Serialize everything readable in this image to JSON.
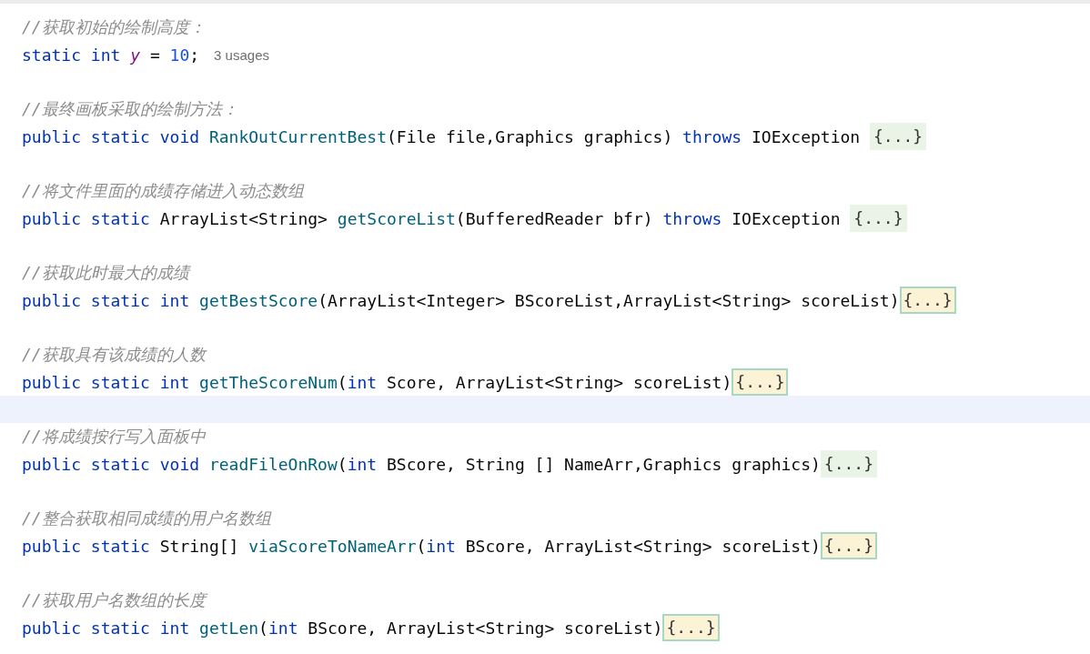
{
  "editor": {
    "lines": [
      {
        "kind": "comment",
        "text": "//获取初始的绘制高度："
      },
      {
        "kind": "code",
        "tokens": [
          {
            "kind": "keyword",
            "text": "static int "
          },
          {
            "kind": "field",
            "text": "y"
          },
          {
            "kind": "plain",
            "text": " = "
          },
          {
            "kind": "number",
            "text": "10"
          },
          {
            "kind": "plain",
            "text": ";"
          }
        ],
        "hint": "3 usages"
      },
      {
        "kind": "blank"
      },
      {
        "kind": "comment",
        "text": "//最终画板采取的绘制方法："
      },
      {
        "kind": "code",
        "tokens": [
          {
            "kind": "keyword",
            "text": "public static void "
          },
          {
            "kind": "function",
            "text": "RankOutCurrentBest"
          },
          {
            "kind": "plain",
            "text": "(File file,Graphics graphics) "
          },
          {
            "kind": "keyword",
            "text": "throws "
          },
          {
            "kind": "plain",
            "text": "IOException "
          }
        ],
        "fold": {
          "text": "{...}",
          "selected": false
        }
      },
      {
        "kind": "blank"
      },
      {
        "kind": "comment",
        "text": "//将文件里面的成绩存储进入动态数组"
      },
      {
        "kind": "code",
        "tokens": [
          {
            "kind": "keyword",
            "text": "public static "
          },
          {
            "kind": "plain",
            "text": "ArrayList<String> "
          },
          {
            "kind": "function",
            "text": "getScoreList"
          },
          {
            "kind": "plain",
            "text": "(BufferedReader bfr) "
          },
          {
            "kind": "keyword",
            "text": "throws "
          },
          {
            "kind": "plain",
            "text": "IOException "
          }
        ],
        "fold": {
          "text": "{...}",
          "selected": false
        }
      },
      {
        "kind": "blank"
      },
      {
        "kind": "comment",
        "text": "//获取此时最大的成绩"
      },
      {
        "kind": "code",
        "tokens": [
          {
            "kind": "keyword",
            "text": "public static int "
          },
          {
            "kind": "function",
            "text": "getBestScore"
          },
          {
            "kind": "plain",
            "text": "(ArrayList<Integer> BScoreList,ArrayList<String> scoreList)"
          }
        ],
        "fold": {
          "text": "{...}",
          "selected": true
        }
      },
      {
        "kind": "blank"
      },
      {
        "kind": "comment",
        "text": "//获取具有该成绩的人数"
      },
      {
        "kind": "code",
        "tokens": [
          {
            "kind": "keyword",
            "text": "public static int "
          },
          {
            "kind": "function",
            "text": "getTheScoreNum"
          },
          {
            "kind": "plain",
            "text": "("
          },
          {
            "kind": "keyword",
            "text": "int "
          },
          {
            "kind": "plain",
            "text": "Score, ArrayList<String> scoreList)"
          }
        ],
        "fold": {
          "text": "{...}",
          "selected": true
        }
      },
      {
        "kind": "current"
      },
      {
        "kind": "comment",
        "text": "//将成绩按行写入面板中"
      },
      {
        "kind": "code",
        "tokens": [
          {
            "kind": "keyword",
            "text": "public static void "
          },
          {
            "kind": "function",
            "text": "readFileOnRow"
          },
          {
            "kind": "plain",
            "text": "("
          },
          {
            "kind": "keyword",
            "text": "int "
          },
          {
            "kind": "plain",
            "text": "BScore, String [] NameArr,Graphics graphics)"
          }
        ],
        "fold": {
          "text": "{...}",
          "selected": false
        }
      },
      {
        "kind": "blank"
      },
      {
        "kind": "comment",
        "text": "//整合获取相同成绩的用户名数组"
      },
      {
        "kind": "code",
        "tokens": [
          {
            "kind": "keyword",
            "text": "public static "
          },
          {
            "kind": "plain",
            "text": "String[] "
          },
          {
            "kind": "function",
            "text": "viaScoreToNameArr"
          },
          {
            "kind": "plain",
            "text": "("
          },
          {
            "kind": "keyword",
            "text": "int "
          },
          {
            "kind": "plain",
            "text": "BScore, ArrayList<String> scoreList)"
          }
        ],
        "fold": {
          "text": "{...}",
          "selected": true
        }
      },
      {
        "kind": "blank"
      },
      {
        "kind": "comment",
        "text": "//获取用户名数组的长度"
      },
      {
        "kind": "code",
        "tokens": [
          {
            "kind": "keyword",
            "text": "public static int "
          },
          {
            "kind": "function",
            "text": "getLen"
          },
          {
            "kind": "plain",
            "text": "("
          },
          {
            "kind": "keyword",
            "text": "int "
          },
          {
            "kind": "plain",
            "text": "BScore, ArrayList<String> scoreList)"
          }
        ],
        "fold": {
          "text": "{...}",
          "selected": true
        }
      }
    ]
  }
}
